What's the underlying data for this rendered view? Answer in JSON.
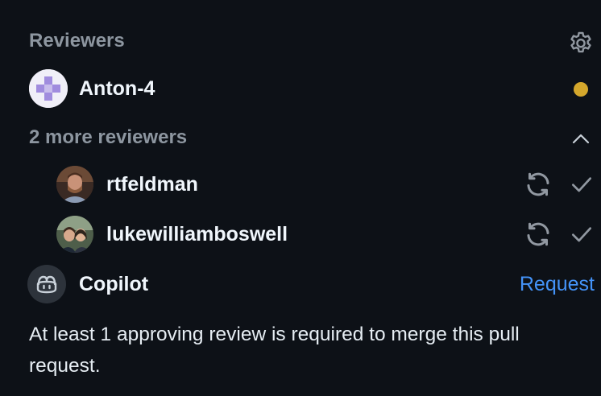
{
  "section": {
    "title": "Reviewers",
    "settings_icon": "gear-icon"
  },
  "primary_reviewer": {
    "name": "Anton-4",
    "status": "pending",
    "status_color": "#d4a72c",
    "avatar_icon": "identicon-avatar"
  },
  "more_reviewers": {
    "label": "2 more reviewers",
    "expanded": true,
    "toggle_icon": "chevron-up-icon",
    "items": [
      {
        "name": "rtfeldman",
        "actions": [
          "sync-icon",
          "check-icon"
        ]
      },
      {
        "name": "lukewilliamboswell",
        "actions": [
          "sync-icon",
          "check-icon"
        ]
      }
    ]
  },
  "copilot": {
    "name": "Copilot",
    "avatar_icon": "copilot-icon",
    "action_label": "Request"
  },
  "requirement_note": "At least 1 approving review is required to merge this pull request.",
  "colors": {
    "background": "#0d1117",
    "muted_text": "#8d96a0",
    "link": "#4493f8",
    "pending": "#d4a72c"
  }
}
